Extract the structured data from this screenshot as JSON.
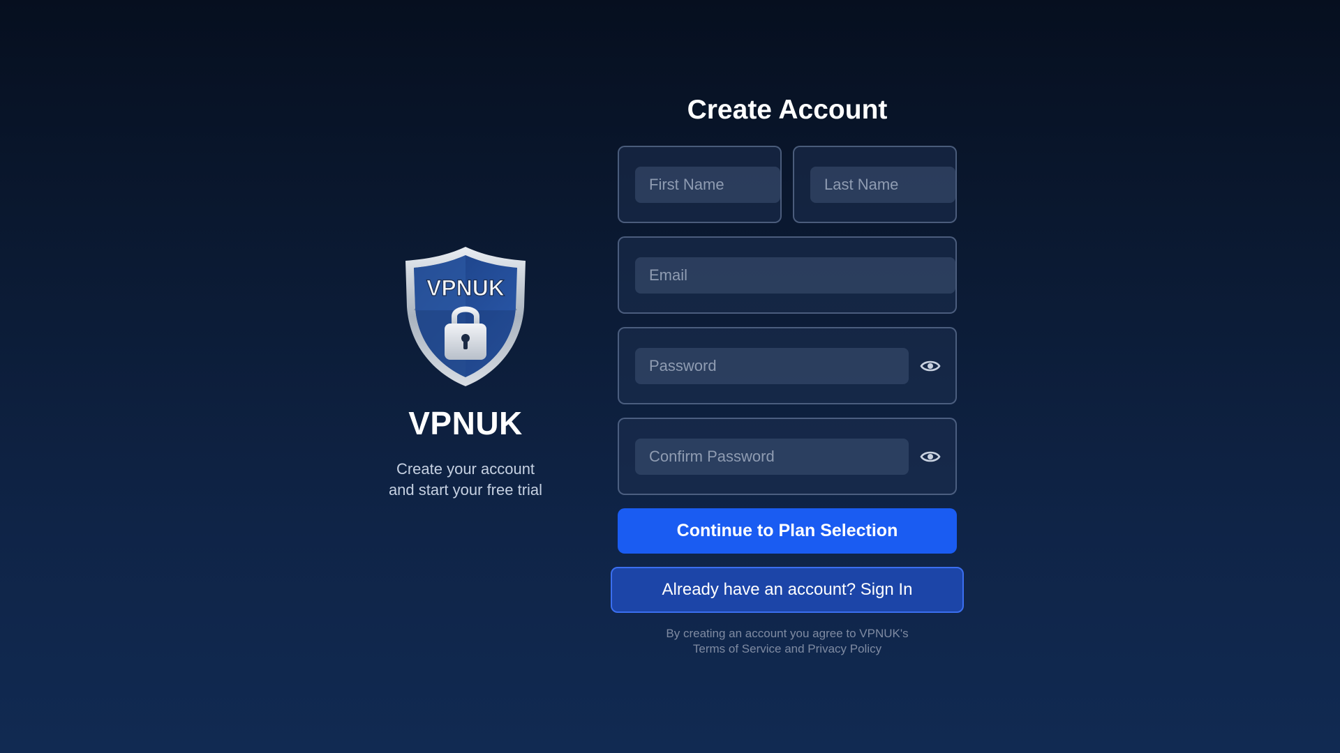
{
  "brand": {
    "logo_text": "VPNUK",
    "name": "VPNUK",
    "tagline_line1": "Create your account",
    "tagline_line2": "and start your free trial"
  },
  "form": {
    "title": "Create Account",
    "first_name": {
      "placeholder": "First Name",
      "value": ""
    },
    "last_name": {
      "placeholder": "Last Name",
      "value": ""
    },
    "email": {
      "placeholder": "Email",
      "value": ""
    },
    "password": {
      "placeholder": "Password",
      "value": ""
    },
    "confirm_password": {
      "placeholder": "Confirm Password",
      "value": ""
    },
    "continue_label": "Continue to Plan Selection",
    "signin_label": "Already have an account? Sign In",
    "legal_line1": "By creating an account you agree to VPNUK's",
    "legal_line2": "Terms of Service and Privacy Policy"
  },
  "icons": {
    "password_toggle": "eye-icon",
    "confirm_password_toggle": "eye-icon",
    "logo": "shield-lock-icon"
  },
  "colors": {
    "primary_button": "#1a5cf2",
    "secondary_button": "#1c45a8",
    "secondary_border": "#3b6ff0"
  }
}
